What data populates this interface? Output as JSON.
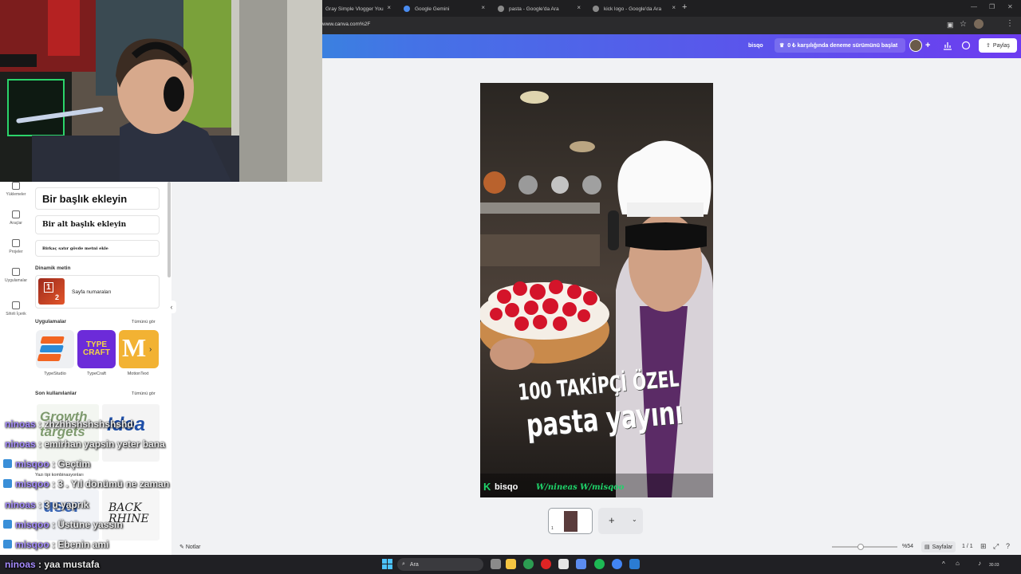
{
  "browser": {
    "tabs": [
      {
        "label": "Gray Simple Vlogger You"
      },
      {
        "label": "Google Gemini"
      },
      {
        "label": "pasta - Google'da Ara"
      },
      {
        "label": "kick logo - Google'da Ara"
      }
    ],
    "new_tab": "+",
    "close_glyph": "×",
    "url": "www.canva.com%2F"
  },
  "canva": {
    "header": {
      "user": "bisqo",
      "trial": "0 ₺ karşılığında deneme sürümünü başlat",
      "share": "Paylaş"
    },
    "rail": [
      {
        "label": "Yüklemeler",
        "icon": "cloud-upload-icon"
      },
      {
        "label": "Araçlar",
        "icon": "pen-icon"
      },
      {
        "label": "Projeler",
        "icon": "folder-icon"
      },
      {
        "label": "Uygulamalar",
        "icon": "apps-icon"
      },
      {
        "label": "Sihirli İçerik",
        "icon": "magic-icon"
      }
    ],
    "panel": {
      "heading": "Bir başlık ekleyin",
      "subheading": "Bir alt başlık ekleyin",
      "body": "Birkaç satır gövde metni ekle",
      "dynamic_section": "Dinamik metin",
      "page_numbers": "Sayfa numaraları",
      "page_numbers_icon_digits": [
        "1",
        "2"
      ],
      "apps_section": "Uygulamalar",
      "apps_see_all": "Tümünü gör",
      "apps": [
        {
          "label": "TypeStudio",
          "color": "#f26522"
        },
        {
          "label": "TypeCraft",
          "color": "#6c2bd9"
        },
        {
          "label": "MotionText",
          "color": "#f2b233"
        }
      ],
      "typecraft_logo": "TYPE CRAFT",
      "recent_section": "Son kullanılanlar",
      "recent_see_all": "Tümünü gör",
      "font_combos": "Yazı tipi kombinasyonları",
      "combo_growth": "Growth targets",
      "combo_idea": "Idea",
      "combo_user": "user",
      "combo_back": "BACK RHINE"
    },
    "design": {
      "line1": "100 TAKİPÇİ ÖZEL",
      "line2": "pasta yayını",
      "brand": "bisqo",
      "brand_k": "K",
      "handles": "W/nineas W/misqoo"
    },
    "page_thumb_number": "1",
    "add_page": "+",
    "notes": "Notlar",
    "zoom": "%54",
    "pages_label": "Sayfalar",
    "page_count": "1 / 1"
  },
  "chat": [
    {
      "user": "ninoas",
      "msg": "zhzhhshshshshshd",
      "badge": false
    },
    {
      "user": "ninoas",
      "msg": "emirhan yapsin yeter bana",
      "badge": false
    },
    {
      "user": "misqoo",
      "msg": "Geçtim",
      "badge": true
    },
    {
      "user": "misqoo",
      "msg": "3 . Yıl dönümü ne zaman",
      "badge": true
    },
    {
      "user": "ninoas",
      "msg": "3 u yaprık",
      "badge": false
    },
    {
      "user": "misqoo",
      "msg": "Üstüne yassın",
      "badge": true
    },
    {
      "user": "misqoo",
      "msg": "Ebenin ami",
      "badge": true
    },
    {
      "user": "ninoas",
      "msg": "yaa mustafa",
      "badge": false
    }
  ],
  "taskbar": {
    "search": "Ara",
    "time": "30.03"
  },
  "colors": {
    "chat_user": "#a58cff",
    "accent": "#7d2ae8"
  }
}
